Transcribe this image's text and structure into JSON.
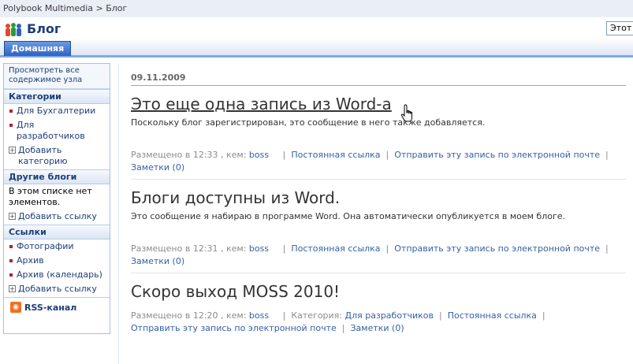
{
  "breadcrumb": {
    "site": "Polybook Multimedia",
    "sep": ">",
    "page": "Блог"
  },
  "header": {
    "title": "Блог",
    "search_label": "Этот"
  },
  "nav": {
    "home_tab": "Домашняя"
  },
  "leftnav": {
    "view_all": "Просмотреть все содержимое узла",
    "categories": {
      "title": "Категории",
      "items": [
        "Для Бухгалтерии",
        "Для разработчиков"
      ],
      "add": "Добавить категорию"
    },
    "other_blogs": {
      "title": "Другие блоги",
      "empty": "В этом списке нет элементов.",
      "add": "Добавить ссылку"
    },
    "links": {
      "title": "Ссылки",
      "items": [
        "Фотографии",
        "Архив",
        "Архив (календарь)"
      ],
      "add": "Добавить ссылку"
    },
    "rss": "RSS-канал"
  },
  "date": "09.11.2009",
  "posts": [
    {
      "title": "Это еще одна запись из Word-а",
      "body": "Поскольку блог зарегистрирован, это сообщение в него также добавляется.",
      "posted": "Размещено в 12:33 , кем:",
      "author": "boss",
      "permalink": "Постоянная ссылка",
      "email": "Отправить эту запись по электронной почте",
      "comments": "Заметки (0)"
    },
    {
      "title": "Блоги доступны из Word.",
      "body": "Это сообщение я набираю в программе Word. Она автоматически опубликуется в моем блоге.",
      "posted": "Размещено в 12:31 , кем:",
      "author": "boss",
      "permalink": "Постоянная ссылка",
      "email": "Отправить эту запись по электронной почте",
      "comments": "Заметки (0)"
    },
    {
      "title": "Скоро выход MOSS 2010!",
      "posted": "Размещено в 12:20 , кем:",
      "author": "boss",
      "category_label": "Категория:",
      "category": "Для разработчиков",
      "permalink": "Постоянная ссылка",
      "email": "Отправить эту запись по электронной почте",
      "comments": "Заметки (0)"
    }
  ],
  "colors": {
    "link": "#3660a6",
    "nav_blue": "#1e3e77",
    "tab_blue": "#2d62c4",
    "rss_orange": "#f26e22"
  }
}
